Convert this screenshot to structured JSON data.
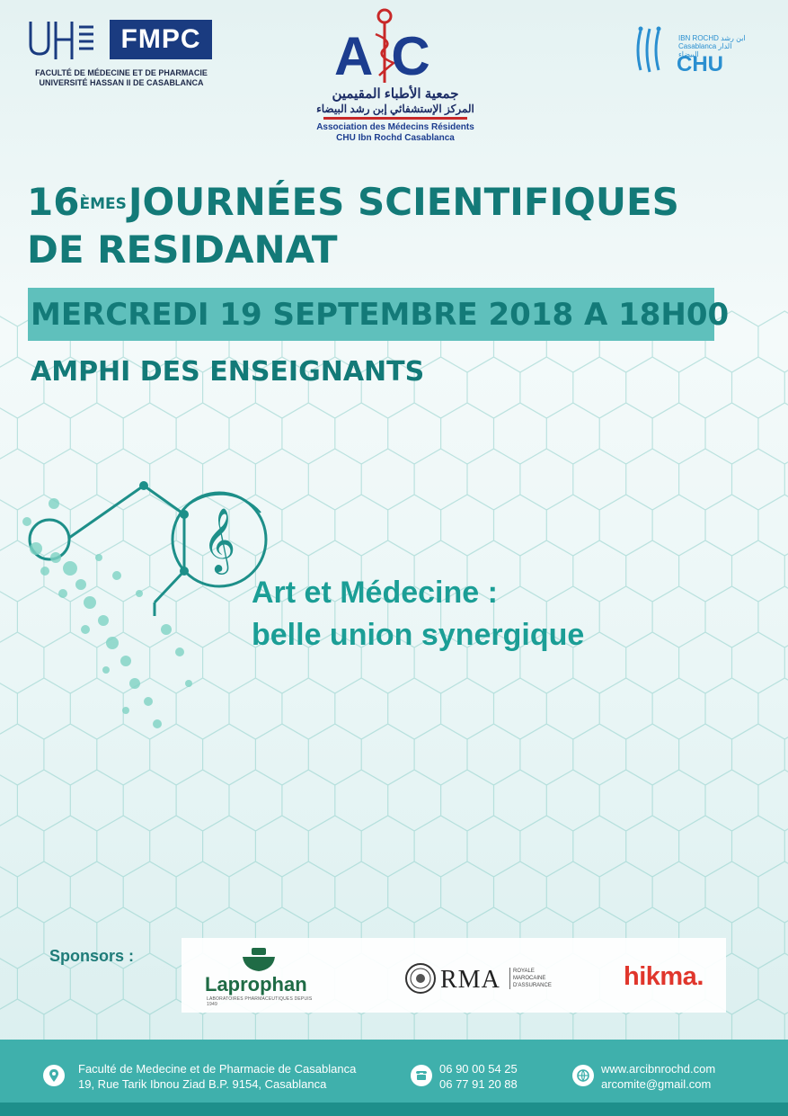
{
  "header": {
    "fmpc": {
      "abbr": "FMPC",
      "line1": "FACULTÉ DE MÉDECINE ET DE PHARMACIE",
      "line2": "UNIVERSITÉ HASSAN II DE CASABLANCA"
    },
    "arc": {
      "a": "A",
      "r": "R",
      "c": "C",
      "arabic1": "جمعية الأطباء المقيمين",
      "arabic2": "المركز الإستشفائي إبن رشد البيضاء",
      "fr1": "Association des Médecins Résidents",
      "fr2": "CHU Ibn Rochd Casablanca"
    },
    "chu": {
      "small1": "IBN ROCHD  ابن رشد",
      "small2": "Casablanca  الدار البيضاء",
      "name": "CHU"
    }
  },
  "event": {
    "number": "16",
    "number_sup": "ÈMES",
    "title_line1": "JOURNÉES SCIENTIFIQUES",
    "title_line2": "DE RESIDANAT",
    "date": "MERCREDI 19 SEPTEMBRE 2018 A 18H00",
    "venue": "AMPHI DES ENSEIGNANTS"
  },
  "theme": {
    "line1": "Art et Médecine :",
    "line2": "belle union synergique"
  },
  "sponsors": {
    "label": "Sponsors :",
    "laprophan": {
      "name": "Laprophan",
      "tagline": "LABORATOIRES PHARMACEUTIQUES DEPUIS 1949"
    },
    "rma": {
      "name": "RMA",
      "sub1": "ROYALE",
      "sub2": "MAROCAINE",
      "sub3": "D'ASSURANCE"
    },
    "hikma": {
      "name": "hikma."
    }
  },
  "footer": {
    "address_line1": "Faculté de Medecine et de Pharmacie de Casablanca",
    "address_line2": "19, Rue Tarik Ibnou Ziad B.P. 9154, Casablanca",
    "phone1": "06 90 00 54 25",
    "phone2": "06 77 91 20 88",
    "web": "www.arcibnrochd.com",
    "email": "arcomite@gmail.com"
  },
  "colors": {
    "teal_dark": "#137a78",
    "teal_band": "#5fc0bc",
    "theme": "#1b9e96",
    "footer": "#3fb0ac"
  },
  "icons": [
    "location-pin-icon",
    "phone-icon",
    "globe-icon",
    "music-note-icon"
  ]
}
